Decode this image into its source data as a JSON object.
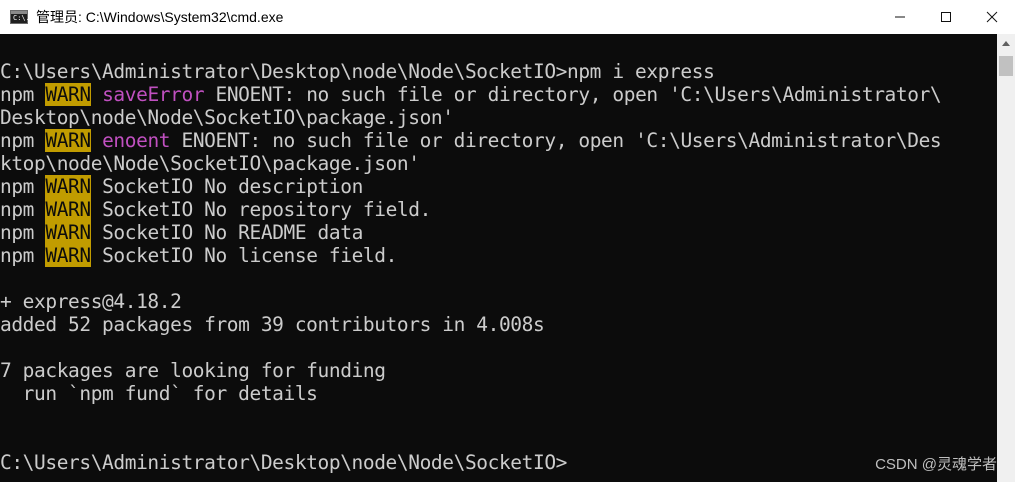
{
  "window": {
    "title": "管理员: C:\\Windows\\System32\\cmd.exe",
    "icon_text": "C:\\.",
    "controls": {
      "minimize": "minimize-icon",
      "maximize": "maximize-icon",
      "close": "close-icon"
    }
  },
  "console": {
    "lines": [
      {
        "segments": [
          {
            "text": "C:\\Users\\Administrator\\Desktop\\node\\Node\\SocketIO>npm i express",
            "style": ""
          }
        ]
      },
      {
        "segments": [
          {
            "text": "npm ",
            "style": ""
          },
          {
            "text": "WARN",
            "style": "warn"
          },
          {
            "text": " ",
            "style": ""
          },
          {
            "text": "saveError",
            "style": "magenta"
          },
          {
            "text": " ENOENT: no such file or directory, open 'C:\\Users\\Administrator\\",
            "style": ""
          }
        ]
      },
      {
        "segments": [
          {
            "text": "Desktop\\node\\Node\\SocketIO\\package.json'",
            "style": ""
          }
        ]
      },
      {
        "segments": [
          {
            "text": "npm ",
            "style": ""
          },
          {
            "text": "WARN",
            "style": "warn"
          },
          {
            "text": " ",
            "style": ""
          },
          {
            "text": "enoent",
            "style": "magenta"
          },
          {
            "text": " ENOENT: no such file or directory, open 'C:\\Users\\Administrator\\Des",
            "style": ""
          }
        ]
      },
      {
        "segments": [
          {
            "text": "ktop\\node\\Node\\SocketIO\\package.json'",
            "style": ""
          }
        ]
      },
      {
        "segments": [
          {
            "text": "npm ",
            "style": ""
          },
          {
            "text": "WARN",
            "style": "warn"
          },
          {
            "text": " SocketIO No description",
            "style": ""
          }
        ]
      },
      {
        "segments": [
          {
            "text": "npm ",
            "style": ""
          },
          {
            "text": "WARN",
            "style": "warn"
          },
          {
            "text": " SocketIO No repository field.",
            "style": ""
          }
        ]
      },
      {
        "segments": [
          {
            "text": "npm ",
            "style": ""
          },
          {
            "text": "WARN",
            "style": "warn"
          },
          {
            "text": " SocketIO No README data",
            "style": ""
          }
        ]
      },
      {
        "segments": [
          {
            "text": "npm ",
            "style": ""
          },
          {
            "text": "WARN",
            "style": "warn"
          },
          {
            "text": " SocketIO No license field.",
            "style": ""
          }
        ]
      },
      {
        "segments": [
          {
            "text": "",
            "style": ""
          }
        ]
      },
      {
        "segments": [
          {
            "text": "+ express@4.18.2",
            "style": ""
          }
        ]
      },
      {
        "segments": [
          {
            "text": "added 52 packages from 39 contributors in 4.008s",
            "style": ""
          }
        ]
      },
      {
        "segments": [
          {
            "text": "",
            "style": ""
          }
        ]
      },
      {
        "segments": [
          {
            "text": "7 packages are looking for funding",
            "style": ""
          }
        ]
      },
      {
        "segments": [
          {
            "text": "  run `npm fund` for details",
            "style": ""
          }
        ]
      },
      {
        "segments": [
          {
            "text": "",
            "style": ""
          }
        ]
      },
      {
        "segments": [
          {
            "text": "",
            "style": ""
          }
        ]
      },
      {
        "segments": [
          {
            "text": "C:\\Users\\Administrator\\Desktop\\node\\Node\\SocketIO>",
            "style": ""
          }
        ]
      }
    ]
  },
  "colors": {
    "background": "#0c0c0c",
    "foreground": "#cccccc",
    "warn_bg": "#c19c00",
    "magenta": "#c050c0"
  },
  "watermark": "CSDN @灵魂学者"
}
